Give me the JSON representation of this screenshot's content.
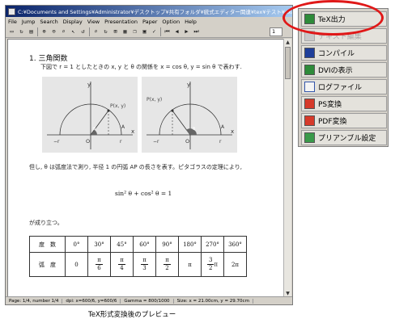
{
  "window": {
    "title": "C:¥Documents and Settings¥Administrator¥デスクトップ¥共有フォルダ¥統式エディター関連¥tex¥テスト¥example1.dvi - dviout",
    "menu": [
      "File",
      "Jump",
      "Search",
      "Display",
      "View",
      "Presentation",
      "Paper",
      "Option",
      "Help"
    ],
    "page_field": "1",
    "status": {
      "page": "Page: 1/4, number 1/4",
      "dpi": "dpi: x=600/6, y=600/6",
      "gamma": "Gamma = 800/1000",
      "size": "Size: x = 21.00cm, y = 29.70cm"
    }
  },
  "document": {
    "section_title": "1. 三角関数",
    "intro": "下図で r = 1 としたときの x, y と θ の関係を x = cos θ, y = sin θ で表わす.",
    "figure_labels": {
      "y": "y",
      "x": "x",
      "r": "r",
      "neg_r": "−r",
      "origin": "O",
      "point_p": "P(x, y)",
      "point_a": "A",
      "theta": "θ"
    },
    "paragraph": "但し, θ は弧度法で測り, 半径 1 の円弧 AP の長さを表す。ピタゴラスの定理により,",
    "formula": "sin² θ + cos² θ = 1",
    "holds": "が成り立つ。",
    "table": {
      "row1_header": "度　数",
      "degrees": [
        "0°",
        "30°",
        "45°",
        "60°",
        "90°",
        "180°",
        "270°",
        "360°"
      ],
      "row2_header": "弧　度",
      "radians": [
        {
          "text": "0"
        },
        {
          "num": "π",
          "den": "6"
        },
        {
          "num": "π",
          "den": "4"
        },
        {
          "num": "π",
          "den": "3"
        },
        {
          "num": "π",
          "den": "2"
        },
        {
          "text": "π"
        },
        {
          "num": "3",
          "den": "2",
          "suffix": "π"
        },
        {
          "text": "2π"
        }
      ]
    }
  },
  "side_menu": {
    "items": [
      {
        "label": "TeX出力",
        "icon": "tex-output-icon",
        "enabled": true
      },
      {
        "label": "テキスト編集",
        "icon": "text-edit-icon",
        "enabled": false
      },
      {
        "label": "コンパイル",
        "icon": "compile-icon",
        "enabled": true
      },
      {
        "label": "DVIの表示",
        "icon": "dvi-view-icon",
        "enabled": true
      },
      {
        "label": "ログファイル",
        "icon": "log-file-icon",
        "enabled": true
      },
      {
        "label": "PS変換",
        "icon": "ps-convert-icon",
        "enabled": true
      },
      {
        "label": "PDF変換",
        "icon": "pdf-convert-icon",
        "enabled": true
      },
      {
        "label": "プリアンブル設定",
        "icon": "preamble-settings-icon",
        "enabled": true
      }
    ]
  },
  "caption": "TeX形式変換後のプレビュー",
  "colors": {
    "highlight_ring": "#e01818",
    "titlebar": "#0a246a",
    "figure_bg": "#e6e6e6"
  }
}
